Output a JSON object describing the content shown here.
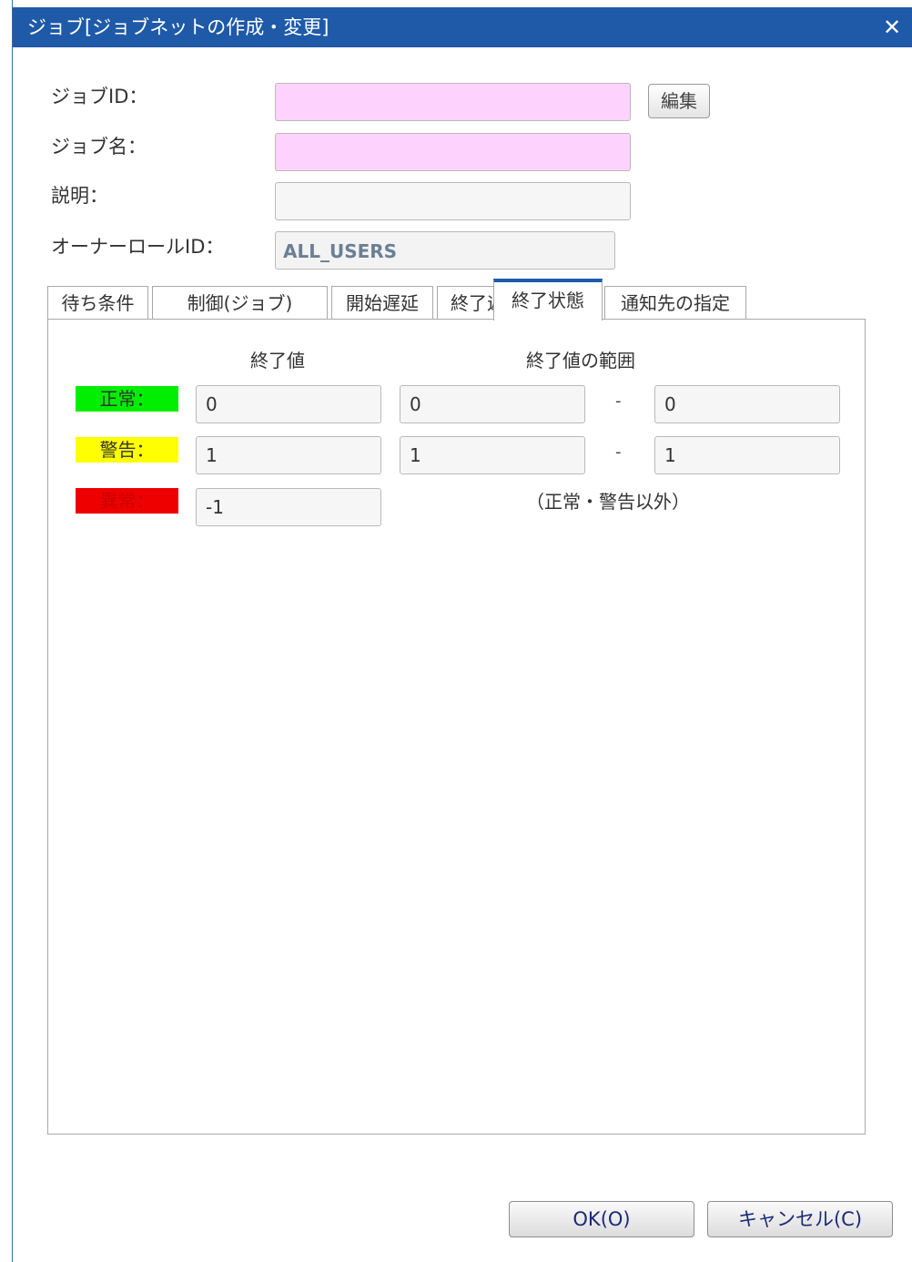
{
  "window": {
    "title": "ジョブ[ジョブネットの作成・変更]",
    "close_glyph": "✕"
  },
  "form": {
    "job_id_label": "ジョブID：",
    "job_id_value": "",
    "edit_button": "編集",
    "job_name_label": "ジョブ名：",
    "job_name_value": "",
    "description_label": "説明：",
    "description_value": "",
    "owner_role_label": "オーナーロールID：",
    "owner_role_value": "ALL_USERS"
  },
  "tabs": [
    {
      "label": "待ち条件"
    },
    {
      "label": "制御(ジョブ)"
    },
    {
      "label": "開始遅延"
    },
    {
      "label": "終了遅延"
    },
    {
      "label": "終了状態",
      "active": true
    },
    {
      "label": "通知先の指定"
    }
  ],
  "end_state": {
    "col_end_value": "終了値",
    "col_range": "終了値の範囲",
    "rows": [
      {
        "label": "正常：",
        "value": "0",
        "range_from": "0",
        "range_to": "0",
        "color": "#00ee00"
      },
      {
        "label": "警告：",
        "value": "1",
        "range_from": "1",
        "range_to": "1",
        "color": "#ffff00"
      },
      {
        "label": "異常：",
        "value": "-1",
        "note": "（正常・警告以外）",
        "color": "#ee0000"
      }
    ],
    "dash": "-"
  },
  "footer": {
    "ok_label": "OK(O)",
    "cancel_label": "キャンセル(C)"
  }
}
